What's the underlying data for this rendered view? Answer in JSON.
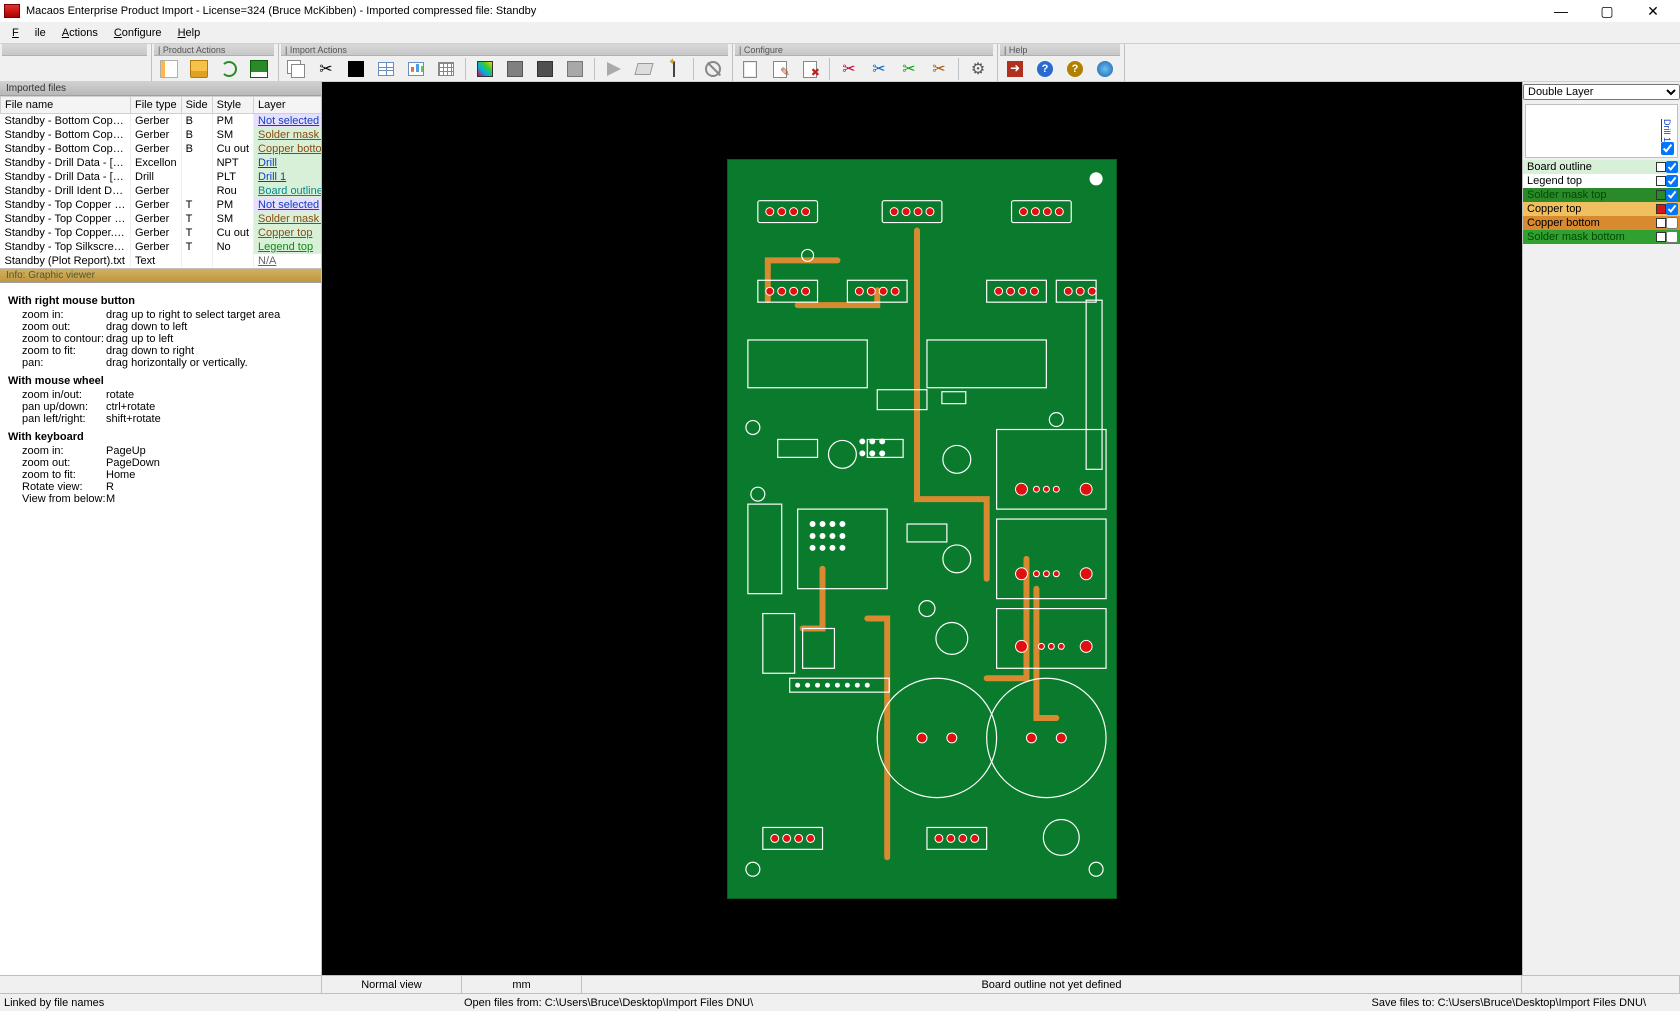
{
  "title": "Macaos Enterprise Product Import  - License=324 (Bruce McKibben)   -   Imported compressed file: Standby",
  "menu": {
    "file": "File",
    "actions": "Actions",
    "configure": "Configure",
    "help": "Help"
  },
  "toolbar_sections": {
    "product": "| Product Actions",
    "import": "| Import Actions",
    "configure": "| Configure",
    "help": "| Help"
  },
  "panel_imported": "Imported files",
  "panel_info": "Info: Graphic viewer",
  "columns": {
    "fn": "File name",
    "ft": "File type",
    "side": "Side",
    "style": "Style",
    "layer": "Layer"
  },
  "files": [
    {
      "fn": "Standby - Bottom Copper (P...",
      "ft": "Gerber",
      "side": "B",
      "style": "PM",
      "layer": "Not selected",
      "cls": "nosel",
      "col": "lk-blue"
    },
    {
      "fn": "Standby - Bottom Copper (R...",
      "ft": "Gerber",
      "side": "B",
      "style": "SM",
      "layer": "Solder mask b...",
      "cls": "",
      "col": "lk-brown"
    },
    {
      "fn": "Standby - Bottom Copper.gbr",
      "ft": "Gerber",
      "side": "B",
      "style": "Cu out",
      "layer": "Copper bottom",
      "cls": "",
      "col": "lk-brown"
    },
    {
      "fn": "Standby - Drill Data - [Throu...",
      "ft": "Excellon",
      "side": "",
      "style": "NPT",
      "layer": "Drill",
      "cls": "",
      "col": "lk-blue"
    },
    {
      "fn": "Standby - Drill Data - [Throu...",
      "ft": "Drill",
      "side": "",
      "style": "PLT",
      "layer": "Drill 1",
      "cls": "",
      "col": "lk-blue"
    },
    {
      "fn": "Standby - Drill Ident Drawing...",
      "ft": "Gerber",
      "side": "",
      "style": "Rou",
      "layer": "Board outline",
      "cls": "",
      "col": "lk-teal"
    },
    {
      "fn": "Standby - Top Copper (Paste...",
      "ft": "Gerber",
      "side": "T",
      "style": "PM",
      "layer": "Not selected",
      "cls": "nosel",
      "col": "lk-blue"
    },
    {
      "fn": "Standby - Top Copper (Resis...",
      "ft": "Gerber",
      "side": "T",
      "style": "SM",
      "layer": "Solder mask top",
      "cls": "",
      "col": "lk-brown"
    },
    {
      "fn": "Standby - Top Copper.gbr",
      "ft": "Gerber",
      "side": "T",
      "style": "Cu out",
      "layer": "Copper top",
      "cls": "",
      "col": "lk-brown"
    },
    {
      "fn": "Standby - Top Silkscreen.gbr",
      "ft": "Gerber",
      "side": "T",
      "style": "No",
      "layer": "Legend top",
      "cls": "",
      "col": "lk-green"
    },
    {
      "fn": "Standby (Plot Report).txt",
      "ft": "Text",
      "side": "",
      "style": "",
      "layer": "N/A",
      "cls": "na",
      "col": "lk-grey"
    }
  ],
  "info": {
    "h1": "With right mouse button",
    "r1": [
      [
        "zoom in:",
        "drag up to right to select target area"
      ],
      [
        "zoom out:",
        "drag down to left"
      ],
      [
        "zoom to contour:",
        "drag up to left"
      ],
      [
        "zoom to fit:",
        "drag down to right"
      ],
      [
        "pan:",
        "drag horizontally or vertically."
      ]
    ],
    "h2": "With mouse wheel",
    "r2": [
      [
        "zoom in/out:",
        "rotate"
      ],
      [
        "pan up/down:",
        "ctrl+rotate"
      ],
      [
        "pan left/right:",
        "shift+rotate"
      ]
    ],
    "h3": "With keyboard",
    "r3": [
      [
        "zoom in:",
        "PageUp"
      ],
      [
        "zoom out:",
        "PageDown"
      ],
      [
        "zoom to fit:",
        "Home"
      ],
      [
        "Rotate view:",
        "R"
      ],
      [
        "View from below:",
        "M"
      ]
    ]
  },
  "right": {
    "mode": "Double Layer",
    "drill": "Drill 1",
    "layers": [
      {
        "name": "Board outline",
        "bg": "#d8f0d8",
        "sw": "#ffffff",
        "chk": true
      },
      {
        "name": "Legend top",
        "bg": "#ffffff",
        "sw": "#ffffff",
        "chk": true
      },
      {
        "name": "Solder mask top",
        "bg": "#2a8a2a",
        "sw": "#2a8a2a",
        "chk": true,
        "fg": "#004a00"
      },
      {
        "name": "Copper top",
        "bg": "#f0c060",
        "sw": "#d01818",
        "chk": true
      },
      {
        "name": "Copper bottom",
        "bg": "#d88a30",
        "sw": "#ffffff",
        "chk": false
      },
      {
        "name": "Solder mask bottom",
        "bg": "#30a030",
        "sw": "#ffffff",
        "chk": false,
        "fg": "#004a00"
      }
    ]
  },
  "status": {
    "view": "Normal view",
    "unit": "mm",
    "outline": "Board outline not yet defined"
  },
  "status2": {
    "linked": "Linked by file names",
    "open": "Open files from: C:\\Users\\Bruce\\Desktop\\Import Files DNU\\",
    "save": "Save files to: C:\\Users\\Bruce\\Desktop\\Import Files DNU\\"
  }
}
